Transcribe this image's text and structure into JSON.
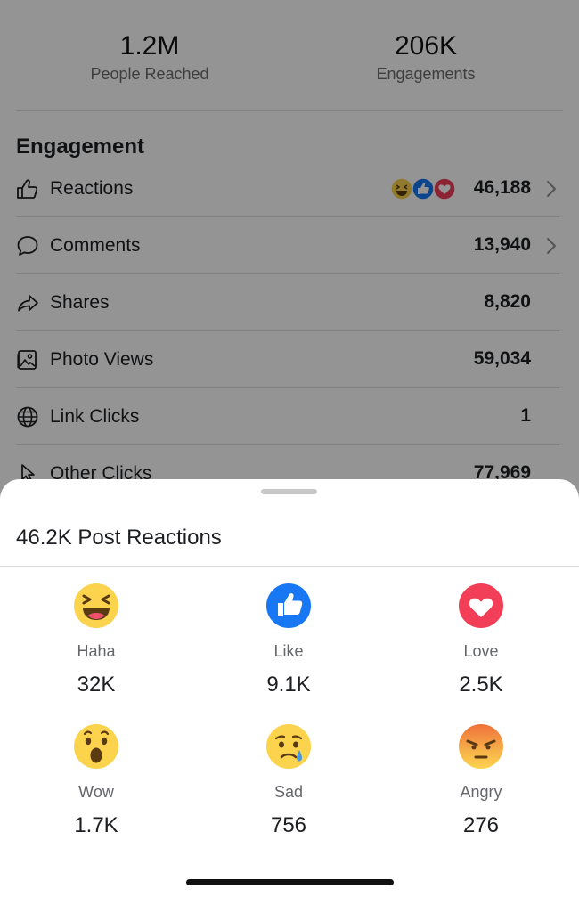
{
  "summary": {
    "people_reached_value": "1.2M",
    "people_reached_label": "People Reached",
    "engagements_value": "206K",
    "engagements_label": "Engagements"
  },
  "engagement": {
    "title": "Engagement",
    "rows": [
      {
        "label": "Reactions",
        "value": "46,188",
        "icon": "thumbs-up-outline-icon"
      },
      {
        "label": "Comments",
        "value": "13,940",
        "icon": "comment-bubble-icon"
      },
      {
        "label": "Shares",
        "value": "8,820",
        "icon": "share-arrow-icon"
      },
      {
        "label": "Photo Views",
        "value": "59,034",
        "icon": "photo-icon"
      },
      {
        "label": "Link Clicks",
        "value": "1",
        "icon": "globe-icon"
      },
      {
        "label": "Other Clicks",
        "value": "77,969",
        "icon": "cursor-icon"
      }
    ]
  },
  "sheet": {
    "title": "46.2K Post Reactions",
    "reactions": [
      {
        "label": "Haha",
        "count": "32K",
        "icon": "haha-emoji-icon"
      },
      {
        "label": "Like",
        "count": "9.1K",
        "icon": "like-emoji-icon"
      },
      {
        "label": "Love",
        "count": "2.5K",
        "icon": "love-emoji-icon"
      },
      {
        "label": "Wow",
        "count": "1.7K",
        "icon": "wow-emoji-icon"
      },
      {
        "label": "Sad",
        "count": "756",
        "icon": "sad-emoji-icon"
      },
      {
        "label": "Angry",
        "count": "276",
        "icon": "angry-emoji-icon"
      }
    ]
  },
  "colors": {
    "like_blue": "#1877f2",
    "love_red": "#f33e58",
    "emoji_yellow": "#fcd34d",
    "angry_orange": "#f0703a"
  }
}
